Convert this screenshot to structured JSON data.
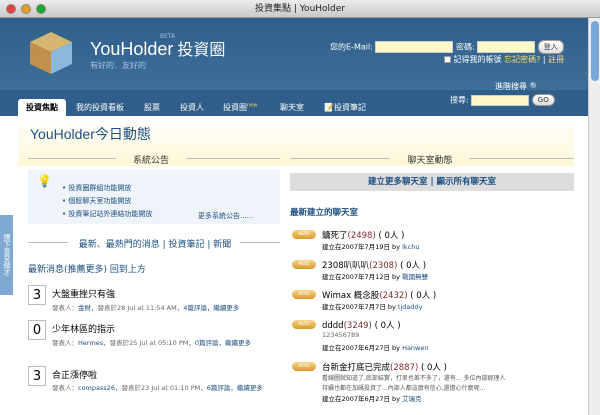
{
  "window": {
    "title": "投資集點 | YouHolder"
  },
  "header": {
    "brand": "YouHolder",
    "brand_zh": "投資圈",
    "beta": "BETA",
    "slogan": "有好的．友好的",
    "email_label": "您的E-Mail:",
    "password_label": "密碼:",
    "login_button": "登入",
    "remember_label": "記得我的帳號",
    "forgot_link": "忘記密碼?",
    "register_link": "註冊"
  },
  "nav": {
    "tabs": [
      {
        "label": "投資焦點"
      },
      {
        "label": "我的投資看板"
      },
      {
        "label": "股票"
      },
      {
        "label": "投資人"
      },
      {
        "label": "投資圈",
        "badge": "new"
      },
      {
        "label": "聊天室"
      },
      {
        "label": "投資筆記"
      }
    ],
    "advanced_search": "進階搜尋",
    "search_label": "搜尋:",
    "search_button": "GO"
  },
  "main": {
    "title": "YouHolder今日動態",
    "feedback_tab": "撰下意見",
    "feedback_tab2": "做才"
  },
  "announcements": {
    "heading": "系統公告",
    "items": [
      "投資圈群組功能開放",
      "個股聊天室功能開放",
      "投資筆記站外連結功能開放"
    ],
    "more": "更多系統公告......"
  },
  "news": {
    "heading": "最新、最熱門的消息 | 投資筆記 | 新聞",
    "subheading_a": "最新消息",
    "subheading_b": "(推薦更多)",
    "subheading_c": "回到上方",
    "posts": [
      {
        "count": "3",
        "title": "大盤重挫只有強",
        "meta_prefix": "發表人：",
        "author": "金財",
        "meta_rest": "，發表於28 Jul at 11:54 AM，",
        "comments": "4篇評論",
        "more": "，繼續更多"
      },
      {
        "count": "0",
        "title": "少年林區的指示",
        "meta_prefix": "發表人：",
        "author": "Hermes",
        "meta_rest": "，發表於25 Jul at 05:10 PM，",
        "comments": "0篇評論",
        "more": "，繼續更多"
      },
      {
        "count": "3",
        "title": "合正漲停啦",
        "meta_prefix": "發表人：",
        "author": "compass26",
        "meta_rest": "，發表於23 Jul at 01:10 PM，",
        "comments": "6篇評論",
        "more": "，繼續更多"
      }
    ]
  },
  "chat": {
    "heading": "聊天室動態",
    "bar_create": "建立更多聊天室",
    "bar_sep": " | ",
    "bar_show": "顯示所有聊天室",
    "newest_heading": "最新建立的聊天室",
    "add_label": "ADD",
    "rooms": [
      {
        "name": "鏞死了",
        "num": "(2498)",
        "people": "( 0人 )",
        "created": "建立在2007年7月19日 by ",
        "user": "lkchu"
      },
      {
        "name": "2308叭叭叭",
        "num": "(2308)",
        "people": "( 0人 )",
        "created": "建立在2007年7月12日 by ",
        "user": "戰國無雙"
      },
      {
        "name": "Wimax 概念股",
        "num": "(2432)",
        "people": "( 0人 )",
        "created": "建立在2007年7月7日 by ",
        "user": "tjdaddy"
      },
      {
        "name": "dddd",
        "num": "(3249)",
        "people": "( 0人 )",
        "created": "123456789",
        "user": "",
        "created2": "建立在2007年6月27日 by ",
        "user2": "Hanwen"
      },
      {
        "name": "台新金打底已完成",
        "num": "(2887)",
        "people": "( 0人 )",
        "created": "看線圖就知道了,底部結實，打呆也差不多了，還有... 多位內部經理人",
        "user": "",
        "created2": "持續也都在加碼投資了...內部人都這麼有信心,還擔心什麼呢...",
        "created3": "建立在2007年6月27日 by ",
        "user3": "艾瑞克"
      }
    ]
  }
}
